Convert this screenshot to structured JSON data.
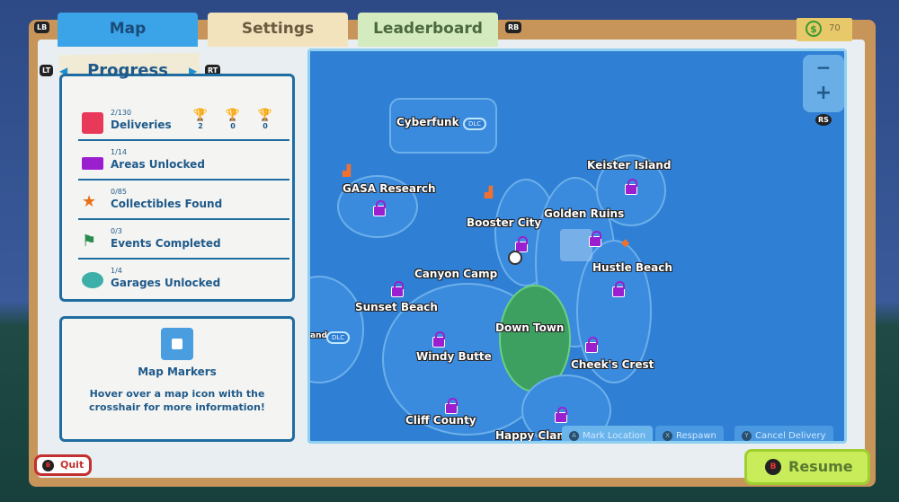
{
  "tabs": [
    {
      "label": "Map",
      "active": true
    },
    {
      "label": "Settings"
    },
    {
      "label": "Leaderboard"
    }
  ],
  "bumpers": {
    "left": "LB",
    "right": "RB",
    "lt": "LT",
    "rt": "RT",
    "rs": "RS"
  },
  "currency": {
    "icon": "dollar-coin-icon",
    "value": "70"
  },
  "progress": {
    "title": "Progress",
    "items": [
      {
        "icon": "package-icon",
        "count": "2/130",
        "label": "Deliveries"
      },
      {
        "icon": "unlock-icon",
        "count": "1/14",
        "label": "Areas Unlocked"
      },
      {
        "icon": "star-box-icon",
        "count": "0/85",
        "label": "Collectibles Found"
      },
      {
        "icon": "flag-icon",
        "count": "0/3",
        "label": "Events Completed"
      },
      {
        "icon": "garage-icon",
        "count": "1/4",
        "label": "Garages Unlocked"
      }
    ],
    "trophies": [
      {
        "tier": "gold",
        "color": "#e6a21a",
        "value": "2"
      },
      {
        "tier": "silver",
        "color": "#9a9a9a",
        "value": "0"
      },
      {
        "tier": "bronze",
        "color": "#c0642a",
        "value": "0"
      }
    ]
  },
  "markers": {
    "title": "Map Markers",
    "desc": "Hover over a map icon with the crosshair for more information!"
  },
  "map": {
    "zoom_out": "−",
    "zoom_in": "+",
    "dlc": "DLC",
    "areas": [
      "Cyberfunk",
      "GASA Research",
      "Booster City",
      "Golden Ruins",
      "Keister Island",
      "Hustle Beach",
      "Canyon Camp",
      "Sunset Beach",
      "Down Town",
      "Windy Butte",
      "Cheek's Crest",
      "Cliff County",
      "Happy Clam",
      "and"
    ],
    "hints": [
      {
        "button": "A",
        "label": "Mark Location"
      },
      {
        "button": "X",
        "label": "Respawn"
      },
      {
        "button": "Y",
        "label": "Cancel Delivery"
      }
    ]
  },
  "quit": {
    "button": "B",
    "label": "Quit"
  },
  "resume": {
    "button": "B",
    "label": "Resume"
  }
}
